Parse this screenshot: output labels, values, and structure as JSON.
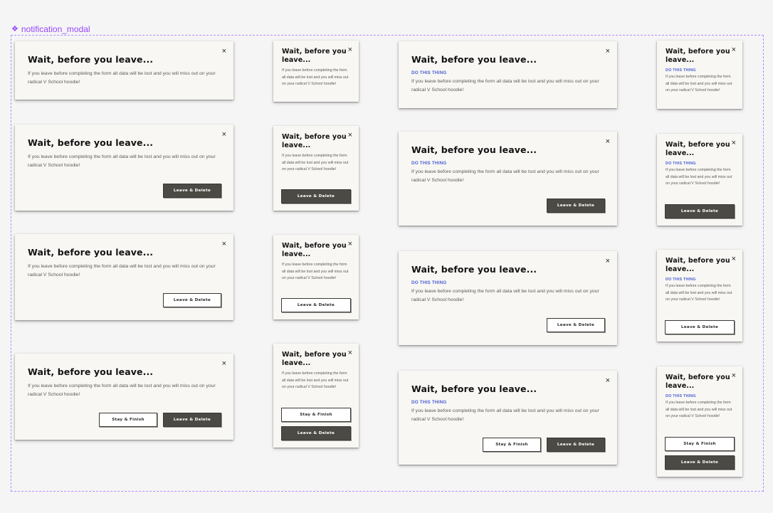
{
  "component": {
    "name": "notification_modal",
    "icon": "component-icon"
  },
  "modal": {
    "title": "Wait, before you leave...",
    "subtitle": "DO THIS THING",
    "body": "If you leave before completing the form all data will be lost and you will miss out on your radical V School hoodie!",
    "close": "×",
    "leave_label": "Leave & Delete",
    "stay_label": "Stay & Finish"
  },
  "colors": {
    "background": "#f5f5f5",
    "card": "#f8f7f4",
    "component_label": "#9747ff",
    "subtitle": "#4b61d1",
    "button_dark": "#4b4a45",
    "button_outline_bg": "#ffffff"
  }
}
